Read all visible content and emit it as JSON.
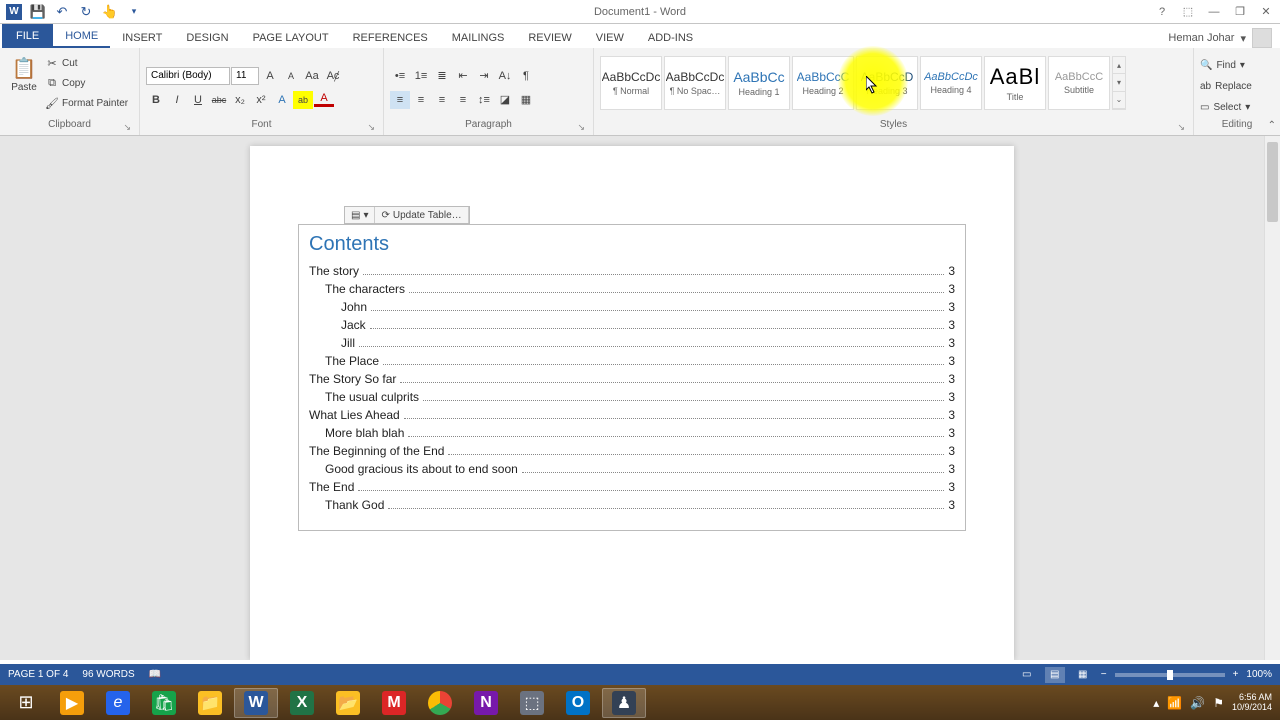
{
  "titlebar": {
    "title": "Document1 - Word"
  },
  "qat": {
    "word": "W",
    "save": "💾",
    "undo": "↶",
    "redo": "↻",
    "touch": "👆",
    "more": "▾"
  },
  "window": {
    "help": "?",
    "ribbon_opts": "⬚",
    "min": "—",
    "restore": "❐",
    "close": "✕"
  },
  "user": {
    "name": "Heman Johar",
    "drop": "▾"
  },
  "tabs": {
    "file": "FILE",
    "home": "HOME",
    "insert": "INSERT",
    "design": "DESIGN",
    "page_layout": "PAGE LAYOUT",
    "references": "REFERENCES",
    "mailings": "MAILINGS",
    "review": "REVIEW",
    "view": "VIEW",
    "addins": "ADD-INS"
  },
  "clipboard": {
    "paste": "Paste",
    "cut": "Cut",
    "copy": "Copy",
    "format_painter": "Format Painter",
    "label": "Clipboard"
  },
  "font": {
    "name": "Calibri (Body)",
    "size": "11",
    "grow": "A",
    "shrink": "A",
    "case": "Aa",
    "clear": "⌫",
    "bold": "B",
    "italic": "I",
    "underline": "U",
    "strike": "abc",
    "sub": "x₂",
    "super": "x²",
    "effects": "A",
    "highlight": "ab",
    "color": "A",
    "label": "Font"
  },
  "paragraph": {
    "bullets": "≡",
    "numbers": "≡",
    "multilevel": "≡",
    "dec_indent": "⇤",
    "inc_indent": "⇥",
    "sort": "A↓",
    "marks": "¶",
    "align_l": "≡",
    "align_c": "≡",
    "align_r": "≡",
    "justify": "≡",
    "spacing": "↕",
    "shading": "▦",
    "borders": "▦",
    "label": "Paragraph"
  },
  "styles": {
    "preview": "AaBbCcDc",
    "preview_h1": "AaBbCc",
    "preview_h2": "AaBbCcC",
    "preview_h3": "AaBbCcD",
    "preview_h4": "AaBbCcDc",
    "preview_title": "AaBl",
    "preview_sub": "AaBbCcC",
    "normal": "¶ Normal",
    "no_spacing": "¶ No Spac…",
    "heading1": "Heading 1",
    "heading2": "Heading 2",
    "heading3": "Heading 3",
    "heading4": "Heading 4",
    "title": "Title",
    "subtitle": "Subtitle",
    "label": "Styles"
  },
  "editing": {
    "find": "Find",
    "replace": "Replace",
    "select": "Select",
    "label": "Editing",
    "drop": "▾"
  },
  "toc": {
    "update_btn": "Update Table…",
    "title": "Contents",
    "items": [
      {
        "label": "The story",
        "page": "3",
        "lvl": 1
      },
      {
        "label": "The characters",
        "page": "3",
        "lvl": 2
      },
      {
        "label": "John",
        "page": "3",
        "lvl": 3
      },
      {
        "label": "Jack",
        "page": "3",
        "lvl": 3
      },
      {
        "label": "Jill",
        "page": "3",
        "lvl": 3
      },
      {
        "label": "The Place",
        "page": "3",
        "lvl": 2
      },
      {
        "label": "The Story So far",
        "page": "3",
        "lvl": 1
      },
      {
        "label": "The usual culprits",
        "page": "3",
        "lvl": 2
      },
      {
        "label": "What Lies Ahead",
        "page": "3",
        "lvl": 1
      },
      {
        "label": "More blah blah",
        "page": "3",
        "lvl": 2
      },
      {
        "label": "The Beginning of the End",
        "page": "3",
        "lvl": 1
      },
      {
        "label": "Good gracious its about to end soon",
        "page": "3",
        "lvl": 2
      },
      {
        "label": "The End",
        "page": "3",
        "lvl": 1
      },
      {
        "label": "Thank God",
        "page": "3",
        "lvl": 2
      }
    ]
  },
  "status": {
    "page": "PAGE 1 OF 4",
    "words": "96 WORDS",
    "proof": "📖",
    "zoom": "100%"
  },
  "taskbar": {
    "start": "⊞",
    "media": "▶",
    "ie": "e",
    "store": "🛍",
    "explorer": "📁",
    "word": "W",
    "excel": "X",
    "folder": "📂",
    "app1": "M",
    "chrome": "◉",
    "onenote": "N",
    "app2": "⬚",
    "outlook": "O",
    "app3": "♟"
  },
  "tray": {
    "up": "▴",
    "net": "📶",
    "vol": "🔊",
    "flag": "⚑",
    "time": "6:56 AM",
    "date": "10/9/2014"
  }
}
